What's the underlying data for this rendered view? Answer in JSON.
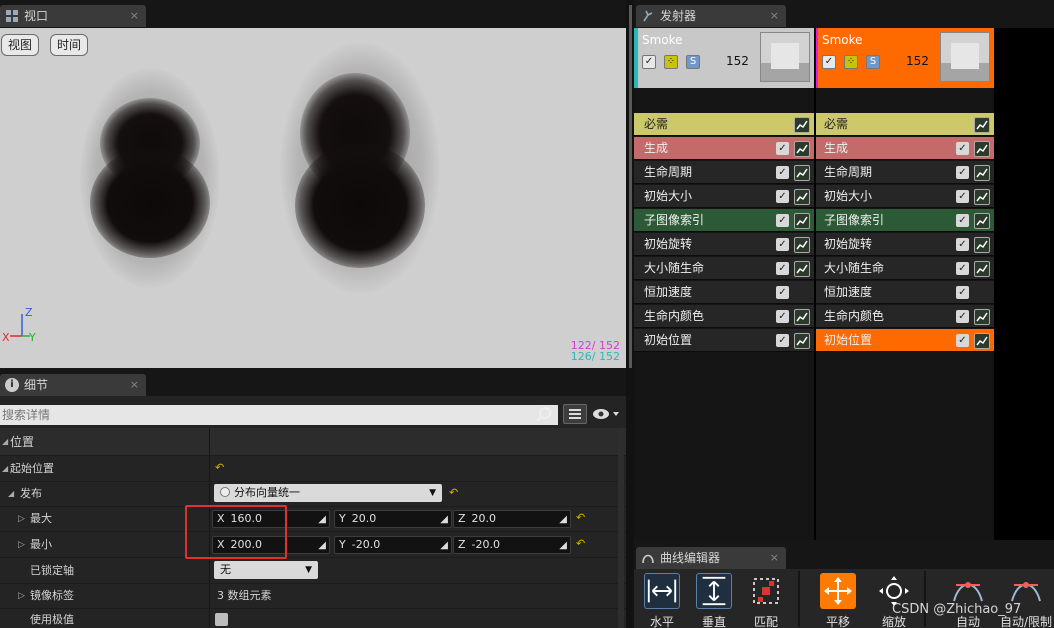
{
  "viewport_tab": {
    "label": "视口",
    "close": "×"
  },
  "viewport": {
    "btn_view": "视图",
    "btn_time": "时间",
    "axis": {
      "z": "Z",
      "x": "X",
      "y": "Y"
    },
    "stats": [
      "122/ 152",
      "126/ 152"
    ]
  },
  "details_tab": {
    "label": "细节",
    "close": "×"
  },
  "details": {
    "search_placeholder": "搜索详情",
    "section": "位置",
    "rows": {
      "start_location": "起始位置",
      "distribution": "发布",
      "distribution_value": "分布向量统一",
      "max": "最大",
      "min": "最小",
      "locked_axis": "已锁定轴",
      "locked_axis_value": "无",
      "mirror_flags": "镜像标签",
      "mirror_flags_value": "3 数组元素",
      "use_extremes": "使用极值"
    },
    "max_vec": {
      "x_label": "X",
      "x": "160.0",
      "y_label": "Y",
      "y": "20.0",
      "z_label": "Z",
      "z": "20.0"
    },
    "min_vec": {
      "x_label": "X",
      "x": "200.0",
      "y_label": "Y",
      "y": "-20.0",
      "z_label": "Z",
      "z": "-20.0"
    }
  },
  "emitters_tab": {
    "label": "发射器",
    "close": "×"
  },
  "emitters": [
    {
      "name": "Smoke",
      "count": "152",
      "minis": [
        "✓",
        "⁘",
        "S"
      ]
    },
    {
      "name": "Smoke",
      "count": "152",
      "minis": [
        "✓",
        "⁘",
        "S"
      ]
    }
  ],
  "modules": [
    "必需",
    "生成",
    "生命周期",
    "初始大小",
    "子图像索引",
    "初始旋转",
    "大小随生命",
    "恒加速度",
    "生命内颜色",
    "初始位置"
  ],
  "colors": {
    "required": "#cdc86a",
    "spawn": "#c46a6a",
    "subimage": "#2d5a36",
    "accent_orange": "#ff6a00",
    "emitter_cyan": "#29b8b8",
    "emitter_magenta": "#e020e0",
    "stat_magenta": "#d23cd2",
    "stat_cyan": "#2fb6b6"
  },
  "curve_editor_tab": {
    "label": "曲线编辑器",
    "close": "×"
  },
  "curve_editor": {
    "tools": [
      "水平",
      "垂直",
      "匹配",
      "平移",
      "缩放",
      "自动",
      "自动/限制"
    ]
  },
  "watermark": "CSDN @Zhichao_97"
}
